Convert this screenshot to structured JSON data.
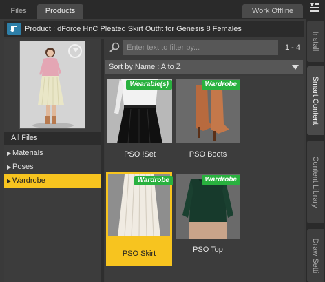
{
  "top_tabs": {
    "files": "Files",
    "products": "Products",
    "work_offline": "Work Offline"
  },
  "product": {
    "back_icon": "back-arrow-icon",
    "title": "Product :  dForce HnC Pleated Skirt Outfit for Genesis 8 Females"
  },
  "left_panel": {
    "all_files": "All Files",
    "categories": [
      {
        "label": "Materials",
        "selected": false
      },
      {
        "label": "Poses",
        "selected": false
      },
      {
        "label": "Wardrobe",
        "selected": true
      }
    ]
  },
  "search": {
    "placeholder": "Enter text to filter by...",
    "value": "",
    "count": "1 - 4"
  },
  "sort": {
    "label": "Sort by Name : A to Z"
  },
  "items": [
    {
      "badge": "Wearable(s)",
      "label": "PSO !Set",
      "selected": false
    },
    {
      "badge": "Wardrobe",
      "label": "PSO Boots",
      "selected": false
    },
    {
      "badge": "Wardrobe",
      "label": "PSO Skirt",
      "selected": true
    },
    {
      "badge": "Wardrobe",
      "label": "PSO Top",
      "selected": false
    }
  ],
  "side_tabs": [
    "Install",
    "Smart Content",
    "Content Library",
    "Draw Setti"
  ],
  "colors": {
    "accent": "#f7c41f",
    "badge": "#29b13f",
    "back_button": "#2e7fa8"
  }
}
